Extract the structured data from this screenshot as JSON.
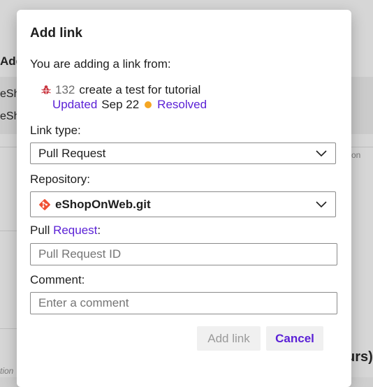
{
  "background": {
    "text_top": "Add",
    "row1": "eSh",
    "row2": "eSh",
    "right_muted": "on",
    "bottom_left": "tion",
    "bottom_right": "urs)"
  },
  "dialog": {
    "title": "Add link",
    "intro": "You are adding a link from:",
    "work_item": {
      "id": "132",
      "title": "create a test for tutorial",
      "updated_label": "Updated",
      "date": "Sep 22",
      "state": "Resolved",
      "icon": "bug-icon",
      "state_color": "#f5a623"
    },
    "link_type": {
      "label": "Link type:",
      "value": "Pull Request"
    },
    "repository": {
      "label": "Repository:",
      "value": "eShopOnWeb.git",
      "icon": "git-icon",
      "icon_color": "#f05033"
    },
    "pull_request": {
      "label_prefix": "Pull ",
      "label_link": "Request",
      "label_suffix": ":",
      "placeholder": "Pull Request ID"
    },
    "comment": {
      "label": "Comment:",
      "placeholder": "Enter a comment"
    },
    "buttons": {
      "add": "Add link",
      "cancel": "Cancel"
    },
    "accent_color": "#5b21d6"
  }
}
